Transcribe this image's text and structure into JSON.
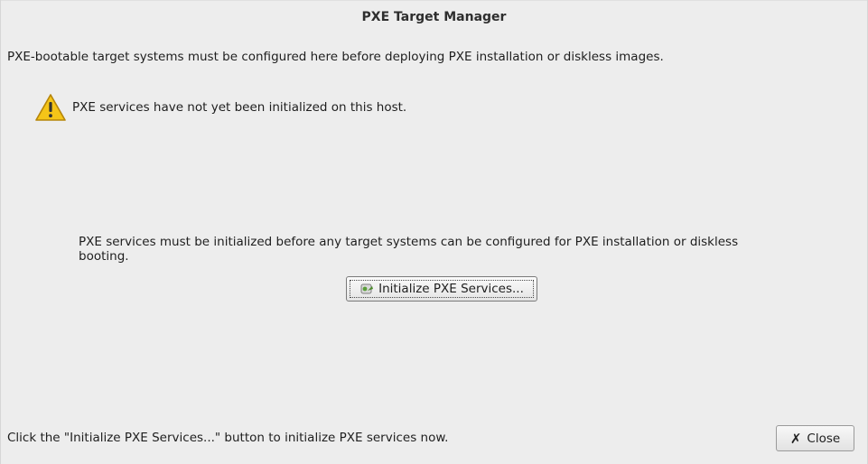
{
  "window": {
    "title": "PXE Target Manager"
  },
  "content": {
    "intro": "PXE-bootable target systems must be configured here before deploying PXE installation or diskless images.",
    "warning": {
      "icon": "warning-icon",
      "text": "PXE services have not yet been initialized on this host."
    },
    "info": "PXE services must be initialized before any target systems can be configured for PXE installation or diskless booting.",
    "init_button": {
      "icon": "service-icon",
      "label": "Initialize PXE Services..."
    }
  },
  "footer": {
    "status": "Click the \"Initialize PXE Services...\" button to initialize PXE services now.",
    "close_button": {
      "icon": "close-icon",
      "label": "Close"
    }
  },
  "colors": {
    "background": "#ededed",
    "warning_yellow": "#f5c518",
    "warning_outline": "#b5850a"
  }
}
